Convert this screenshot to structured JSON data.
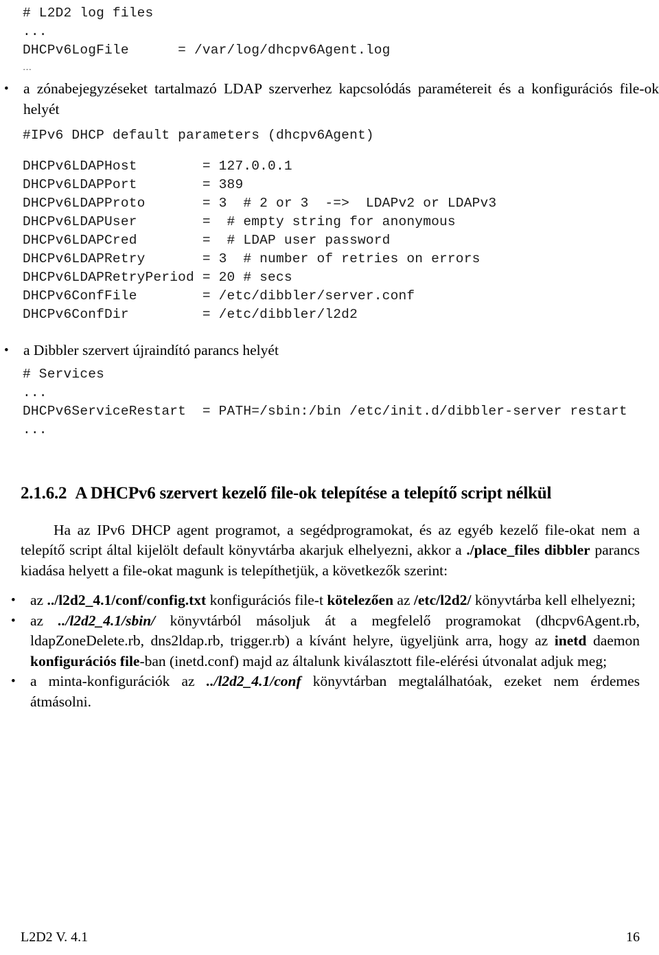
{
  "document": {
    "language": "hu",
    "footer": {
      "left": "L2D2 V. 4.1",
      "page_number": "16"
    }
  },
  "blocks": {
    "log_config": {
      "line1": "# L2D2 log files",
      "line2": "...",
      "line3": "DHCPv6LogFile      = /var/log/dhcpv6Agent.log",
      "line4": "…"
    },
    "bullet_ldap": {
      "marker": "•",
      "text": "a zónabejegyzéseket tartalmazó LDAP szerverhez kapcsolódás paramétereit és a konfigurációs file-ok helyét"
    },
    "ldap_config": {
      "header": "#IPv6 DHCP default parameters (dhcpv6Agent)",
      "lines": [
        "DHCPv6LDAPHost        = 127.0.0.1",
        "DHCPv6LDAPPort        = 389",
        "DHCPv6LDAPProto       = 3  # 2 or 3  -=>  LDAPv2 or LDAPv3",
        "DHCPv6LDAPUser        =  # empty string for anonymous",
        "DHCPv6LDAPCred        =  # LDAP user password",
        "DHCPv6LDAPRetry       = 3  # number of retries on errors",
        "DHCPv6LDAPRetryPeriod = 20 # secs",
        "DHCPv6ConfFile        = /etc/dibbler/server.conf",
        "DHCPv6ConfDir         = /etc/dibbler/l2d2"
      ]
    },
    "bullet_restart": {
      "marker": "•",
      "text": "a Dibbler szervert újraindító parancs helyét"
    },
    "services_config": {
      "line1": "# Services",
      "line2": "...",
      "line3": "DHCPv6ServiceRestart  = PATH=/sbin:/bin /etc/init.d/dibbler-server restart",
      "line4": "..."
    },
    "section_heading": {
      "number": "2.1.6.2",
      "title": "A DHCPv6 szervert kezelő file-ok telepítése a telepítő script nélkül"
    },
    "intro_paragraph": {
      "part1": "Ha az IPv6 DHCP agent programot, a segédprogramokat, és az egyéb kezelő file-okat nem a telepítő script által kijelölt default könyvtárba akarjuk elhelyezni, akkor a ",
      "bold1": "./place_files dibbler",
      "part2": " parancs kiadása helyett a file-okat magunk is telepíthetjük, a következők szerint:"
    },
    "list_items": [
      {
        "marker": "•",
        "part1": "az ",
        "bold1": "../l2d2_4.1/conf/config.txt",
        "part2": " konfigurációs file-t ",
        "bold2": "kötelezően",
        "part3": " az ",
        "bold3": "/etc/l2d2/",
        "part4": " könyvtárba kell elhelyezni;"
      },
      {
        "marker": "•",
        "part1": "az ",
        "bolditalic1": "../l2d2_4.1/sbin/",
        "part2": " könyvtárból másoljuk át a megfelelő programokat (dhcpv6Agent.rb, ldapZoneDelete.rb, dns2ldap.rb, trigger.rb) a kívánt helyre, ügyeljünk arra, hogy az ",
        "bold2": "inetd",
        "part3": " daemon ",
        "bold3": "konfigurációs file",
        "part4": "-ban (inetd.conf) majd az általunk kiválasztott file-elérési útvonalat adjuk meg;"
      },
      {
        "marker": "•",
        "part1": "a minta-konfigurációk az ",
        "bolditalic1": "../l2d2_4.1/conf",
        "part2": " könyvtárban megtalálhatóak, ezeket nem érdemes átmásolni."
      }
    ]
  }
}
